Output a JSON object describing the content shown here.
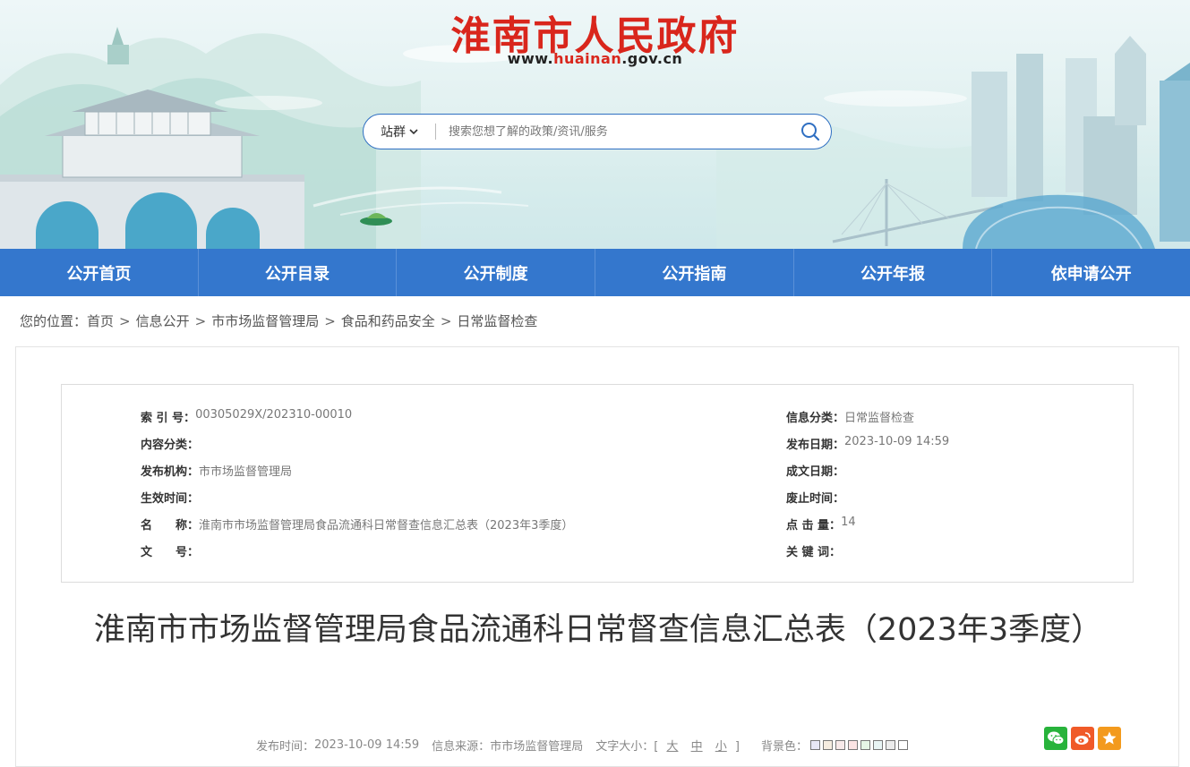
{
  "header": {
    "site_title": "淮南市人民政府",
    "url_prefix": "www.",
    "url_highlight": "huainan",
    "url_suffix": ".gov.cn"
  },
  "search": {
    "scope_label": "站群",
    "placeholder": "搜索您想了解的政策/资讯/服务",
    "icon": "search-icon"
  },
  "nav": {
    "items": [
      {
        "label": "公开首页"
      },
      {
        "label": "公开目录"
      },
      {
        "label": "公开制度"
      },
      {
        "label": "公开指南"
      },
      {
        "label": "公开年报"
      },
      {
        "label": "依申请公开"
      }
    ]
  },
  "breadcrumb": {
    "prefix": "您的位置：",
    "items": [
      "首页",
      "信息公开",
      "市市场监督管理局",
      "食品和药品安全",
      "日常监督检查"
    ],
    "separator": ">"
  },
  "meta": {
    "left": [
      {
        "label": "索 引 号：",
        "value": "00305029X/202310-00010"
      },
      {
        "label": "内容分类：",
        "value": ""
      },
      {
        "label": "发布机构：",
        "value": "市市场监督管理局"
      },
      {
        "label": "生效时间：",
        "value": ""
      },
      {
        "label": "名　　称：",
        "value": "淮南市市场监督管理局食品流通科日常督查信息汇总表（2023年3季度）"
      },
      {
        "label": "文　　号：",
        "value": ""
      }
    ],
    "right": [
      {
        "label": "信息分类：",
        "value": "日常监督检查"
      },
      {
        "label": "发布日期：",
        "value": "2023-10-09 14:59"
      },
      {
        "label": "成文日期：",
        "value": ""
      },
      {
        "label": "废止时间：",
        "value": ""
      },
      {
        "label": "点 击 量：",
        "value": "14"
      },
      {
        "label": "关 键 词：",
        "value": ""
      }
    ]
  },
  "article": {
    "title": "淮南市市场监督管理局食品流通科日常督查信息汇总表（2023年3季度）",
    "publish_time_label": "发布时间：",
    "publish_time": "2023-10-09 14:59",
    "source_label": "信息来源：",
    "source": "市市场监督管理局",
    "font_size_label": "文字大小：[",
    "font_size_close": "]",
    "font_sizes": [
      "大",
      "中",
      "小"
    ],
    "bg_label": "背景色：",
    "bg_colors": [
      "#e8e8f5",
      "#f5ece0",
      "#f7e9e9",
      "#fbe3e3",
      "#e6f5e6",
      "#e8f4f4",
      "#ececec",
      "#ffffff"
    ]
  },
  "share": {
    "items": [
      {
        "icon": "wechat-icon",
        "color": "#28b33b"
      },
      {
        "icon": "weibo-icon",
        "color": "#f05a28"
      },
      {
        "icon": "favorite-star-icon",
        "color": "#f39a1d"
      }
    ]
  },
  "colors": {
    "title_red": "#d9261c",
    "nav_blue": "#3477cd"
  }
}
